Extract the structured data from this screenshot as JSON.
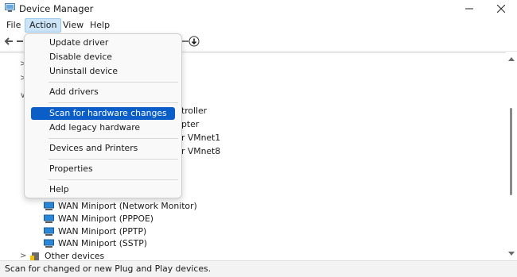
{
  "window": {
    "title": "Device Manager"
  },
  "menubar": {
    "items": [
      "File",
      "Action",
      "View",
      "Help"
    ]
  },
  "action_menu": {
    "items": [
      "Update driver",
      "Disable device",
      "Uninstall device",
      "Add drivers",
      "Scan for hardware changes",
      "Add legacy hardware",
      "Devices and Printers",
      "Properties",
      "Help"
    ],
    "highlighted": "Scan for hardware changes"
  },
  "tree": {
    "partial_rows": [
      "troller",
      "pter",
      "r VMnet1",
      "r VMnet8"
    ],
    "rows": [
      "WAN Miniport (Network Monitor)",
      "WAN Miniport (PPPOE)",
      "WAN Miniport (PPTP)",
      "WAN Miniport (SSTP)"
    ],
    "category": "Other devices"
  },
  "status": {
    "text": "Scan for changed or new Plug and Play devices."
  },
  "colors": {
    "highlight": "#0b5ec8",
    "menu_active_bg": "#cce4f7",
    "adapter_icon": "#2b88d8"
  }
}
